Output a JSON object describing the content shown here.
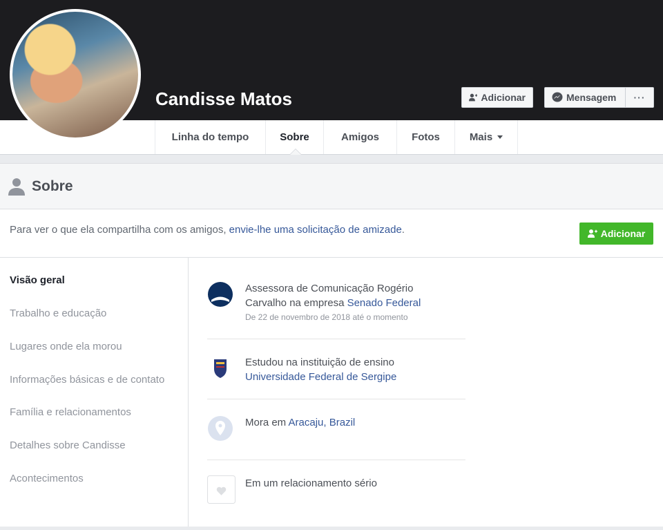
{
  "profile": {
    "name": "Candisse Matos",
    "add_label": "Adicionar",
    "message_label": "Mensagem",
    "more_label": "···"
  },
  "nav": {
    "tabs": [
      {
        "label": "Linha do tempo"
      },
      {
        "label": "Sobre"
      },
      {
        "label": "Amigos"
      },
      {
        "label": "Fotos"
      },
      {
        "label": "Mais"
      }
    ]
  },
  "about": {
    "title": "Sobre",
    "friend_prompt_prefix": "Para ver o que ela compartilha com os amigos, ",
    "friend_prompt_link": "envie-lhe uma solicitação de amizade",
    "friend_prompt_suffix": ".",
    "add_button": "Adicionar"
  },
  "sidebar": {
    "items": [
      {
        "label": "Visão geral"
      },
      {
        "label": "Trabalho e educação"
      },
      {
        "label": "Lugares onde ela morou"
      },
      {
        "label": "Informações básicas e de contato"
      },
      {
        "label": "Família e relacionamentos"
      },
      {
        "label": "Detalhes sobre Candisse"
      },
      {
        "label": "Acontecimentos"
      }
    ]
  },
  "overview": {
    "work": {
      "line1": "Assessora de Comunicação Rogério",
      "line2_prefix": "Carvalho na empresa ",
      "company": "Senado Federal",
      "dates": "De 22 de novembro de 2018 até o momento"
    },
    "education": {
      "line1": "Estudou na instituição de ensino",
      "school": "Universidade Federal de Sergipe"
    },
    "location": {
      "prefix": "Mora em ",
      "city": "Aracaju, Brazil"
    },
    "relationship": {
      "status": "Em um relacionamento sério"
    }
  },
  "colors": {
    "link": "#365899",
    "green": "#42b72a",
    "cover": "#1c1c1f"
  }
}
